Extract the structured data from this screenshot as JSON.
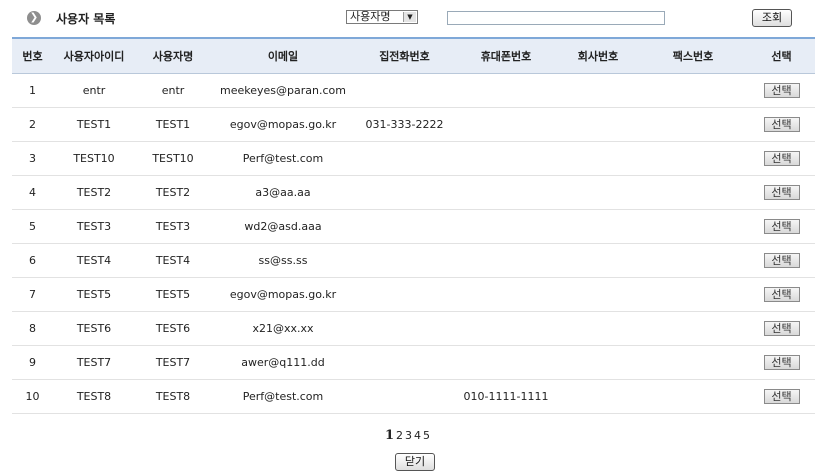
{
  "header": {
    "title": "사용자 목록",
    "icon": "circle-arrow-icon",
    "search_type": "사용자명",
    "search_value": "",
    "search_button": "조회"
  },
  "table": {
    "columns": [
      "번호",
      "사용자아이디",
      "사용자명",
      "이메일",
      "집전화번호",
      "휴대폰번호",
      "회사번호",
      "팩스번호",
      "선택"
    ],
    "rows": [
      {
        "no": "1",
        "id": "entr",
        "name": "entr",
        "email": "meekeyes@paran.com",
        "home": "",
        "mobile": "",
        "office": "",
        "fax": "",
        "select": "선택"
      },
      {
        "no": "2",
        "id": "TEST1",
        "name": "TEST1",
        "email": "egov@mopas.go.kr",
        "home": "031-333-2222",
        "mobile": "",
        "office": "",
        "fax": "",
        "select": "선택"
      },
      {
        "no": "3",
        "id": "TEST10",
        "name": "TEST10",
        "email": "Perf@test.com",
        "home": "",
        "mobile": "",
        "office": "",
        "fax": "",
        "select": "선택"
      },
      {
        "no": "4",
        "id": "TEST2",
        "name": "TEST2",
        "email": "a3@aa.aa",
        "home": "",
        "mobile": "",
        "office": "",
        "fax": "",
        "select": "선택"
      },
      {
        "no": "5",
        "id": "TEST3",
        "name": "TEST3",
        "email": "wd2@asd.aaa",
        "home": "",
        "mobile": "",
        "office": "",
        "fax": "",
        "select": "선택"
      },
      {
        "no": "6",
        "id": "TEST4",
        "name": "TEST4",
        "email": "ss@ss.ss",
        "home": "",
        "mobile": "",
        "office": "",
        "fax": "",
        "select": "선택"
      },
      {
        "no": "7",
        "id": "TEST5",
        "name": "TEST5",
        "email": "egov@mopas.go.kr",
        "home": "",
        "mobile": "",
        "office": "",
        "fax": "",
        "select": "선택"
      },
      {
        "no": "8",
        "id": "TEST6",
        "name": "TEST6",
        "email": "x21@xx.xx",
        "home": "",
        "mobile": "",
        "office": "",
        "fax": "",
        "select": "선택"
      },
      {
        "no": "9",
        "id": "TEST7",
        "name": "TEST7",
        "email": "awer@q111.dd",
        "home": "",
        "mobile": "",
        "office": "",
        "fax": "",
        "select": "선택"
      },
      {
        "no": "10",
        "id": "TEST8",
        "name": "TEST8",
        "email": "Perf@test.com",
        "home": "",
        "mobile": "010-1111-1111",
        "office": "",
        "fax": "",
        "select": "선택"
      }
    ]
  },
  "pagination": {
    "pages": [
      "1",
      "2",
      "3",
      "4",
      "5"
    ],
    "current": "1"
  },
  "footer": {
    "close_button": "닫기"
  },
  "colors": {
    "header_bg": "#e7edf6",
    "header_border": "#7fa8d8"
  }
}
